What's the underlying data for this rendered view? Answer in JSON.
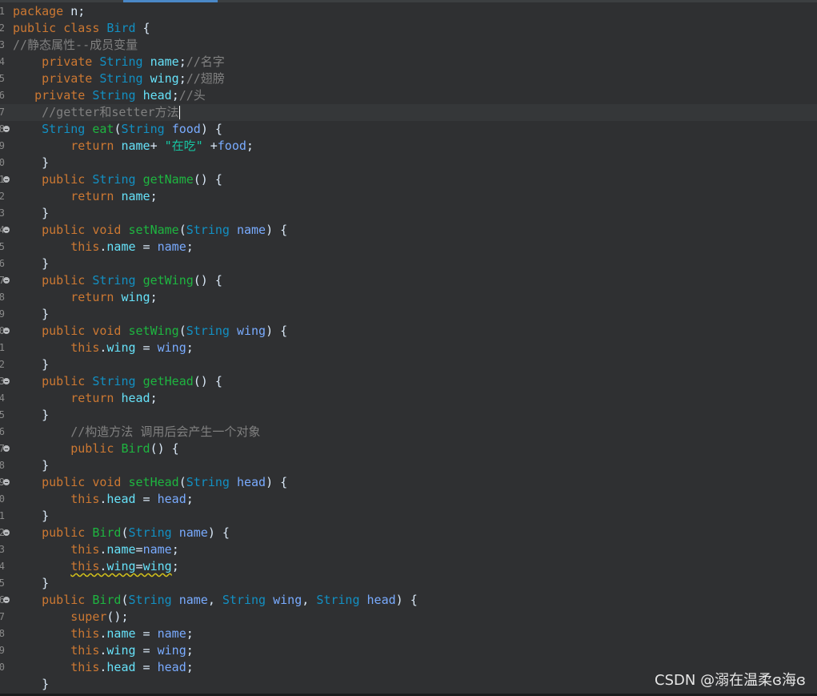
{
  "editor": {
    "lines": [
      {
        "n": "1",
        "fold": false,
        "indent": "",
        "tokens": [
          [
            "kw",
            "package"
          ],
          [
            "pl",
            " n;"
          ]
        ]
      },
      {
        "n": "2",
        "fold": false,
        "indent": "",
        "tokens": [
          [
            "kw",
            "public"
          ],
          [
            "pl",
            " "
          ],
          [
            "kw",
            "class"
          ],
          [
            "pl",
            " "
          ],
          [
            "ty",
            "Bird"
          ],
          [
            "pl",
            " {"
          ]
        ]
      },
      {
        "n": "3",
        "fold": false,
        "indent": "",
        "tokens": [
          [
            "cm",
            "//静态属性--成员变量"
          ]
        ]
      },
      {
        "n": "4",
        "fold": false,
        "indent": "    ",
        "tokens": [
          [
            "kw",
            "private"
          ],
          [
            "pl",
            " "
          ],
          [
            "ty",
            "String"
          ],
          [
            "pl",
            " "
          ],
          [
            "fd",
            "name"
          ],
          [
            "pl",
            ";"
          ],
          [
            "cm",
            "//名字"
          ]
        ]
      },
      {
        "n": "5",
        "fold": false,
        "indent": "    ",
        "tokens": [
          [
            "kw",
            "private"
          ],
          [
            "pl",
            " "
          ],
          [
            "ty",
            "String"
          ],
          [
            "pl",
            " "
          ],
          [
            "fd",
            "wing"
          ],
          [
            "pl",
            ";"
          ],
          [
            "cm",
            "//翅膀"
          ]
        ]
      },
      {
        "n": "6",
        "fold": false,
        "indent": "   ",
        "tokens": [
          [
            "kw",
            "private"
          ],
          [
            "pl",
            " "
          ],
          [
            "ty",
            "String"
          ],
          [
            "pl",
            " "
          ],
          [
            "fd",
            "head"
          ],
          [
            "pl",
            ";"
          ],
          [
            "cm",
            "//头"
          ]
        ]
      },
      {
        "n": "7",
        "fold": false,
        "indent": "    ",
        "current": true,
        "tokens": [
          [
            "cm",
            "//getter和setter方法"
          ],
          [
            "caret",
            ""
          ]
        ]
      },
      {
        "n": "8",
        "fold": true,
        "indent": "    ",
        "tokens": [
          [
            "ty",
            "String"
          ],
          [
            "pl",
            " "
          ],
          [
            "fn",
            "eat"
          ],
          [
            "pl",
            "("
          ],
          [
            "ty",
            "String"
          ],
          [
            "pl",
            " "
          ],
          [
            "pa",
            "food"
          ],
          [
            "pl",
            ") {"
          ]
        ]
      },
      {
        "n": "9",
        "fold": false,
        "indent": "        ",
        "tokens": [
          [
            "kw",
            "return"
          ],
          [
            "pl",
            " "
          ],
          [
            "fd",
            "name"
          ],
          [
            "pl",
            "+ "
          ],
          [
            "st",
            "\"在吃\""
          ],
          [
            "pl",
            " +"
          ],
          [
            "pa",
            "food"
          ],
          [
            "pl",
            ";"
          ]
        ]
      },
      {
        "n": "0",
        "fold": false,
        "indent": "    ",
        "tokens": [
          [
            "pl",
            "}"
          ]
        ]
      },
      {
        "n": "1",
        "fold": true,
        "indent": "    ",
        "tokens": [
          [
            "kw",
            "public"
          ],
          [
            "pl",
            " "
          ],
          [
            "ty",
            "String"
          ],
          [
            "pl",
            " "
          ],
          [
            "fn",
            "getName"
          ],
          [
            "pl",
            "() {"
          ]
        ]
      },
      {
        "n": "2",
        "fold": false,
        "indent": "        ",
        "tokens": [
          [
            "kw",
            "return"
          ],
          [
            "pl",
            " "
          ],
          [
            "fd",
            "name"
          ],
          [
            "pl",
            ";"
          ]
        ]
      },
      {
        "n": "3",
        "fold": false,
        "indent": "    ",
        "tokens": [
          [
            "pl",
            "}"
          ]
        ]
      },
      {
        "n": "4",
        "fold": true,
        "indent": "    ",
        "tokens": [
          [
            "kw",
            "public"
          ],
          [
            "pl",
            " "
          ],
          [
            "kw",
            "void"
          ],
          [
            "pl",
            " "
          ],
          [
            "fn",
            "setName"
          ],
          [
            "pl",
            "("
          ],
          [
            "ty",
            "String"
          ],
          [
            "pl",
            " "
          ],
          [
            "pa",
            "name"
          ],
          [
            "pl",
            ") {"
          ]
        ]
      },
      {
        "n": "5",
        "fold": false,
        "indent": "        ",
        "tokens": [
          [
            "kw",
            "this"
          ],
          [
            "pl",
            "."
          ],
          [
            "fd",
            "name"
          ],
          [
            "pl",
            " = "
          ],
          [
            "pa",
            "name"
          ],
          [
            "pl",
            ";"
          ]
        ]
      },
      {
        "n": "6",
        "fold": false,
        "indent": "    ",
        "tokens": [
          [
            "pl",
            "}"
          ]
        ]
      },
      {
        "n": "7",
        "fold": true,
        "indent": "    ",
        "tokens": [
          [
            "kw",
            "public"
          ],
          [
            "pl",
            " "
          ],
          [
            "ty",
            "String"
          ],
          [
            "pl",
            " "
          ],
          [
            "fn",
            "getWing"
          ],
          [
            "pl",
            "() {"
          ]
        ]
      },
      {
        "n": "8",
        "fold": false,
        "indent": "        ",
        "tokens": [
          [
            "kw",
            "return"
          ],
          [
            "pl",
            " "
          ],
          [
            "fd",
            "wing"
          ],
          [
            "pl",
            ";"
          ]
        ]
      },
      {
        "n": "9",
        "fold": false,
        "indent": "    ",
        "tokens": [
          [
            "pl",
            "}"
          ]
        ]
      },
      {
        "n": "0",
        "fold": true,
        "indent": "    ",
        "tokens": [
          [
            "kw",
            "public"
          ],
          [
            "pl",
            " "
          ],
          [
            "kw",
            "void"
          ],
          [
            "pl",
            " "
          ],
          [
            "fn",
            "setWing"
          ],
          [
            "pl",
            "("
          ],
          [
            "ty",
            "String"
          ],
          [
            "pl",
            " "
          ],
          [
            "pa",
            "wing"
          ],
          [
            "pl",
            ") {"
          ]
        ]
      },
      {
        "n": "1",
        "fold": false,
        "indent": "        ",
        "tokens": [
          [
            "kw",
            "this"
          ],
          [
            "pl",
            "."
          ],
          [
            "fd",
            "wing"
          ],
          [
            "pl",
            " = "
          ],
          [
            "pa",
            "wing"
          ],
          [
            "pl",
            ";"
          ]
        ]
      },
      {
        "n": "2",
        "fold": false,
        "indent": "    ",
        "tokens": [
          [
            "pl",
            "}"
          ]
        ]
      },
      {
        "n": "3",
        "fold": true,
        "indent": "    ",
        "tokens": [
          [
            "kw",
            "public"
          ],
          [
            "pl",
            " "
          ],
          [
            "ty",
            "String"
          ],
          [
            "pl",
            " "
          ],
          [
            "fn",
            "getHead"
          ],
          [
            "pl",
            "() {"
          ]
        ]
      },
      {
        "n": "4",
        "fold": false,
        "indent": "        ",
        "tokens": [
          [
            "kw",
            "return"
          ],
          [
            "pl",
            " "
          ],
          [
            "fd",
            "head"
          ],
          [
            "pl",
            ";"
          ]
        ]
      },
      {
        "n": "5",
        "fold": false,
        "indent": "    ",
        "tokens": [
          [
            "pl",
            "}"
          ]
        ]
      },
      {
        "n": "6",
        "fold": false,
        "indent": "        ",
        "tokens": [
          [
            "cm",
            "//构造方法 调用后会产生一个对象"
          ]
        ]
      },
      {
        "n": "7",
        "fold": true,
        "indent": "        ",
        "tokens": [
          [
            "kw",
            "public"
          ],
          [
            "pl",
            " "
          ],
          [
            "fn",
            "Bird"
          ],
          [
            "pl",
            "() {"
          ]
        ]
      },
      {
        "n": "8",
        "fold": false,
        "indent": "    ",
        "tokens": [
          [
            "pl",
            "}"
          ]
        ]
      },
      {
        "n": "9",
        "fold": true,
        "indent": "    ",
        "tokens": [
          [
            "kw",
            "public"
          ],
          [
            "pl",
            " "
          ],
          [
            "kw",
            "void"
          ],
          [
            "pl",
            " "
          ],
          [
            "fn",
            "setHead"
          ],
          [
            "pl",
            "("
          ],
          [
            "ty",
            "String"
          ],
          [
            "pl",
            " "
          ],
          [
            "pa",
            "head"
          ],
          [
            "pl",
            ") {"
          ]
        ]
      },
      {
        "n": "0",
        "fold": false,
        "indent": "        ",
        "tokens": [
          [
            "kw",
            "this"
          ],
          [
            "pl",
            "."
          ],
          [
            "fd",
            "head"
          ],
          [
            "pl",
            " = "
          ],
          [
            "pa",
            "head"
          ],
          [
            "pl",
            ";"
          ]
        ]
      },
      {
        "n": "1",
        "fold": false,
        "indent": "    ",
        "tokens": [
          [
            "pl",
            "}"
          ]
        ]
      },
      {
        "n": "2",
        "fold": true,
        "indent": "    ",
        "tokens": [
          [
            "kw",
            "public"
          ],
          [
            "pl",
            " "
          ],
          [
            "fn",
            "Bird"
          ],
          [
            "pl",
            "("
          ],
          [
            "ty",
            "String"
          ],
          [
            "pl",
            " "
          ],
          [
            "pa",
            "name"
          ],
          [
            "pl",
            ") {"
          ]
        ]
      },
      {
        "n": "3",
        "fold": false,
        "indent": "        ",
        "tokens": [
          [
            "kw",
            "this"
          ],
          [
            "pl",
            "."
          ],
          [
            "fd",
            "name"
          ],
          [
            "pl",
            "="
          ],
          [
            "pa",
            "name"
          ],
          [
            "pl",
            ";"
          ]
        ]
      },
      {
        "n": "4",
        "fold": false,
        "indent": "        ",
        "tokens": [
          [
            "kw squiggle",
            "this"
          ],
          [
            "pl squiggle",
            "."
          ],
          [
            "fd squiggle",
            "wing"
          ],
          [
            "pl squiggle",
            "="
          ],
          [
            "fd squiggle",
            "wing"
          ],
          [
            "pl",
            ";"
          ]
        ]
      },
      {
        "n": "5",
        "fold": false,
        "indent": "    ",
        "tokens": [
          [
            "pl",
            "}"
          ]
        ]
      },
      {
        "n": "6",
        "fold": true,
        "indent": "    ",
        "tokens": [
          [
            "kw",
            "public"
          ],
          [
            "pl",
            " "
          ],
          [
            "fn",
            "Bird"
          ],
          [
            "pl",
            "("
          ],
          [
            "ty",
            "String"
          ],
          [
            "pl",
            " "
          ],
          [
            "pa",
            "name"
          ],
          [
            "pl",
            ", "
          ],
          [
            "ty",
            "String"
          ],
          [
            "pl",
            " "
          ],
          [
            "pa",
            "wing"
          ],
          [
            "pl",
            ", "
          ],
          [
            "ty",
            "String"
          ],
          [
            "pl",
            " "
          ],
          [
            "pa",
            "head"
          ],
          [
            "pl",
            ") {"
          ]
        ]
      },
      {
        "n": "7",
        "fold": false,
        "indent": "        ",
        "tokens": [
          [
            "kw",
            "super"
          ],
          [
            "pl",
            "();"
          ]
        ]
      },
      {
        "n": "8",
        "fold": false,
        "indent": "        ",
        "tokens": [
          [
            "kw",
            "this"
          ],
          [
            "pl",
            "."
          ],
          [
            "fd",
            "name"
          ],
          [
            "pl",
            " = "
          ],
          [
            "pa",
            "name"
          ],
          [
            "pl",
            ";"
          ]
        ]
      },
      {
        "n": "9",
        "fold": false,
        "indent": "        ",
        "tokens": [
          [
            "kw",
            "this"
          ],
          [
            "pl",
            "."
          ],
          [
            "fd",
            "wing"
          ],
          [
            "pl",
            " = "
          ],
          [
            "pa",
            "wing"
          ],
          [
            "pl",
            ";"
          ]
        ]
      },
      {
        "n": "0",
        "fold": false,
        "indent": "        ",
        "tokens": [
          [
            "kw",
            "this"
          ],
          [
            "pl",
            "."
          ],
          [
            "fd",
            "head"
          ],
          [
            "pl",
            " = "
          ],
          [
            "pa",
            "head"
          ],
          [
            "pl",
            ";"
          ]
        ]
      },
      {
        "n": "",
        "fold": false,
        "indent": "    ",
        "tokens": [
          [
            "pl",
            "}"
          ]
        ]
      }
    ]
  },
  "watermark": {
    "text": "CSDN @溺在温柔ɞ海ɞ"
  },
  "colors": {
    "background": "#2f3032",
    "keyword": "#cc7832",
    "type": "#1290c3",
    "method": "#1eb540",
    "field": "#66e1f8",
    "parameter": "#79abff",
    "comment": "#808080",
    "string": "#17c6a3",
    "plain": "#d9e8f7",
    "tab_indicator": "#4a88c7"
  }
}
